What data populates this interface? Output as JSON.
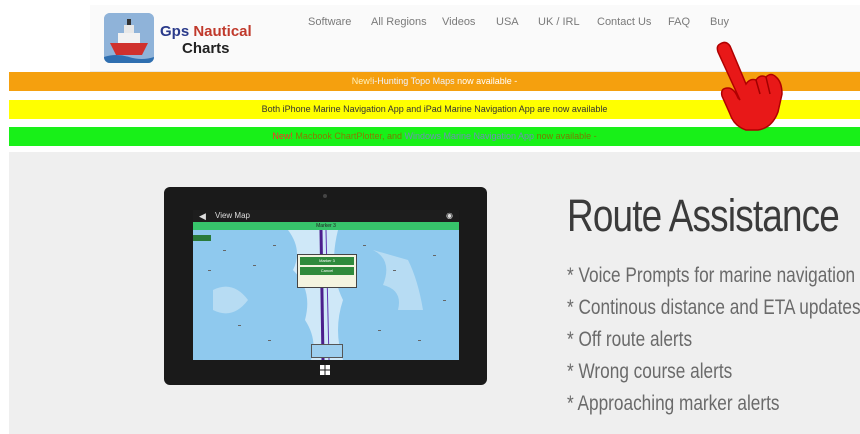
{
  "brand": {
    "line1_a": "Gps ",
    "line1_b": "Nautical",
    "line2": "Charts"
  },
  "nav": [
    {
      "label": "Software"
    },
    {
      "label": "All Regions"
    },
    {
      "label": "Videos"
    },
    {
      "label": "USA"
    },
    {
      "label": "UK / IRL"
    },
    {
      "label": "Contact Us"
    },
    {
      "label": "FAQ"
    },
    {
      "label": "Buy"
    }
  ],
  "banners": {
    "orange": {
      "new": "New!",
      "link": "i-Hunting Topo Maps",
      "rest": " now available -"
    },
    "yellow": {
      "text": "Both iPhone Marine Navigation App  and iPad Marine Navigation App are now available"
    },
    "green": {
      "new": "New!",
      "a": " Macbook ChartPlotter",
      "b": ", and ",
      "c": "Windows Marine Navigation App",
      "d": " now available -"
    }
  },
  "device": {
    "screen_title": "View Map",
    "route_label": "Marker 3",
    "popup_title": "Marker 3",
    "popup_button": "Cancel"
  },
  "hero": {
    "title": "Route Assistance",
    "features": [
      "* Voice Prompts for marine navigation",
      "* Continous distance and ETA updates",
      "* Off route alerts",
      "* Wrong course alerts",
      "* Approaching marker alerts"
    ]
  },
  "colors": {
    "orange": "#f5a00e",
    "yellow": "#ffff00",
    "green": "#18f018",
    "hand": "#e81818"
  }
}
